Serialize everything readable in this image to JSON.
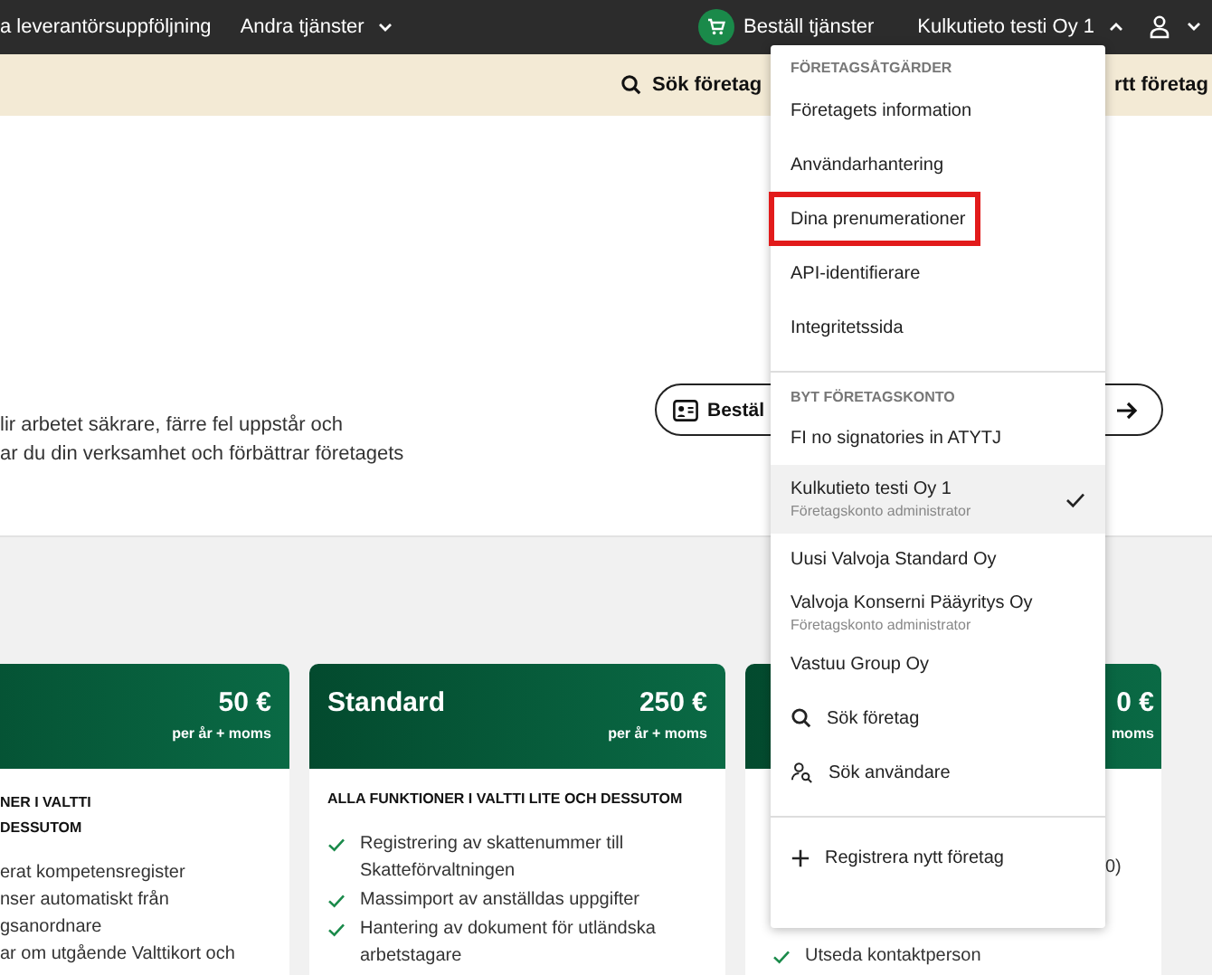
{
  "top_nav": [
    {
      "label": "a leverantörsuppföljning",
      "dropdown": false
    },
    {
      "label": "Andra tjänster",
      "dropdown": true
    }
  ],
  "order_services": {
    "label": "Beställ tjänster"
  },
  "account": {
    "label": "Kulkutieto testi Oy 1",
    "expanded": true
  },
  "subbar": {
    "search": "Sök företag",
    "action": "rtt företag"
  },
  "hero": {
    "lines": [
      "lir arbetet säkrare, färre fel uppstår och",
      "ar du din verksamhet och förbättrar företagets"
    ],
    "order_button": "Bestäl"
  },
  "plans": [
    {
      "kind": "left",
      "price": "50 €",
      "period": "per år + moms",
      "heading_lines": [
        "NER I VALTTI",
        "DESSUTOM"
      ],
      "features": [
        {
          "text": "erat kompetensregister",
          "check": false
        },
        {
          "text": "nser automatiskt från",
          "check": false
        },
        {
          "text": "gsanordnare",
          "check": false
        },
        {
          "text": "ar om utgående Valttikort och",
          "check": false
        }
      ]
    },
    {
      "kind": "full",
      "title": "Standard",
      "price": "250 €",
      "period": "per år + moms",
      "heading_lines": [
        "ALLA FUNKTIONER I VALTTI LITE OCH DESSUTOM"
      ],
      "features": [
        {
          "text": "Registrering av skattenummer till Skatteförvaltningen",
          "check": true
        },
        {
          "text": "Massimport av anställdas uppgifter",
          "check": true
        },
        {
          "text": "Hantering av dokument för utländska arbetstagare",
          "check": true
        }
      ]
    },
    {
      "kind": "covered",
      "price": "0 €",
      "period": "moms",
      "features": [
        {
          "text": "0)",
          "check": false
        },
        {
          "text": "Utseda kontaktperson",
          "check": true
        }
      ]
    }
  ],
  "menu": {
    "company_actions": {
      "heading": "FÖRETAGSÅTGÄRDER",
      "items": [
        {
          "label": "Företagets information",
          "highlighted": false
        },
        {
          "label": "Användarhantering",
          "highlighted": false
        },
        {
          "label": "Dina prenumerationer",
          "highlighted": true
        },
        {
          "label": "API-identifierare",
          "highlighted": false
        },
        {
          "label": "Integritetssida",
          "highlighted": false
        }
      ]
    },
    "switch_account": {
      "heading": "BYT FÖRETAGSKONTO",
      "accounts": [
        {
          "label": "FI no signatories in ATYTJ",
          "selected": false
        },
        {
          "label": "Kulkutieto testi Oy 1",
          "subtitle": "Företagskonto administrator",
          "selected": true
        },
        {
          "label": "Uusi Valvoja Standard Oy",
          "selected": false
        },
        {
          "label": "Valvoja Konserni Pääyritys Oy",
          "subtitle": "Företagskonto administrator",
          "selected": false
        },
        {
          "label": "Vastuu Group Oy",
          "selected": false
        }
      ],
      "tools": [
        {
          "kind": "search",
          "label": "Sök företag"
        },
        {
          "kind": "user-search",
          "label": "Sök användare"
        }
      ]
    },
    "register": {
      "label": "Registrera nytt företag"
    }
  }
}
